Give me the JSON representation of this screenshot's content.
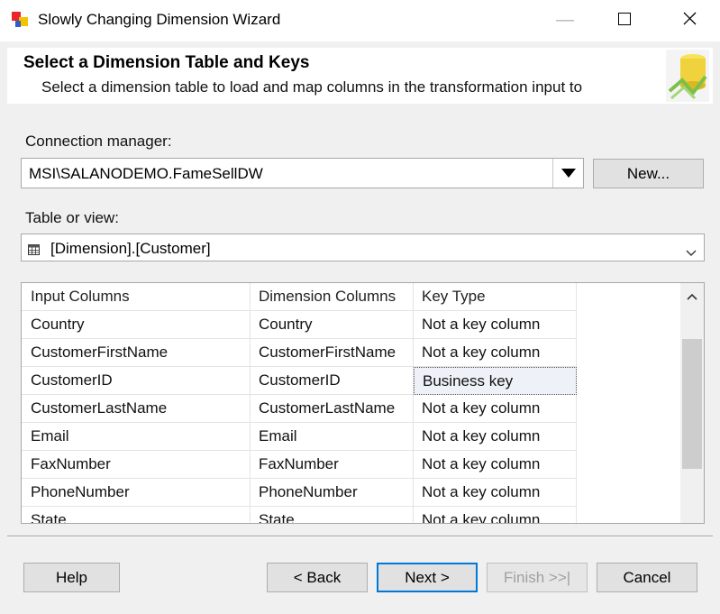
{
  "window": {
    "title": "Slowly Changing Dimension Wizard",
    "minimize_glyph": "—",
    "maximize_glyph": "☐",
    "close_glyph": "✕"
  },
  "header": {
    "title": "Select a Dimension Table and Keys",
    "subtitle": "Select a dimension table to load and map columns in the transformation input to"
  },
  "connection": {
    "label": "Connection manager:",
    "value": "MSI\\SALANODEMO.FameSellDW",
    "new_button": "New..."
  },
  "table": {
    "label": "Table or view:",
    "value": "[Dimension].[Customer]"
  },
  "grid": {
    "columns": [
      "Input Columns",
      "Dimension Columns",
      "Key Type"
    ],
    "rows": [
      {
        "input": "Country",
        "dimension": "Country",
        "key_type": "Not a key column"
      },
      {
        "input": "CustomerFirstName",
        "dimension": "CustomerFirstName",
        "key_type": "Not a key column"
      },
      {
        "input": "CustomerID",
        "dimension": "CustomerID",
        "key_type": "Business key",
        "selected": true
      },
      {
        "input": "CustomerLastName",
        "dimension": "CustomerLastName",
        "key_type": "Not a key column"
      },
      {
        "input": "Email",
        "dimension": "Email",
        "key_type": "Not a key column"
      },
      {
        "input": "FaxNumber",
        "dimension": "FaxNumber",
        "key_type": "Not a key column"
      },
      {
        "input": "PhoneNumber",
        "dimension": "PhoneNumber",
        "key_type": "Not a key column"
      },
      {
        "input": "State",
        "dimension": "State",
        "key_type": "Not a key column"
      }
    ]
  },
  "buttons": {
    "help": "Help",
    "back": "< Back",
    "next": "Next >",
    "finish": "Finish >>|",
    "cancel": "Cancel"
  },
  "colors": {
    "accent": "#0078d7",
    "selection_bg": "#eef2f8"
  }
}
